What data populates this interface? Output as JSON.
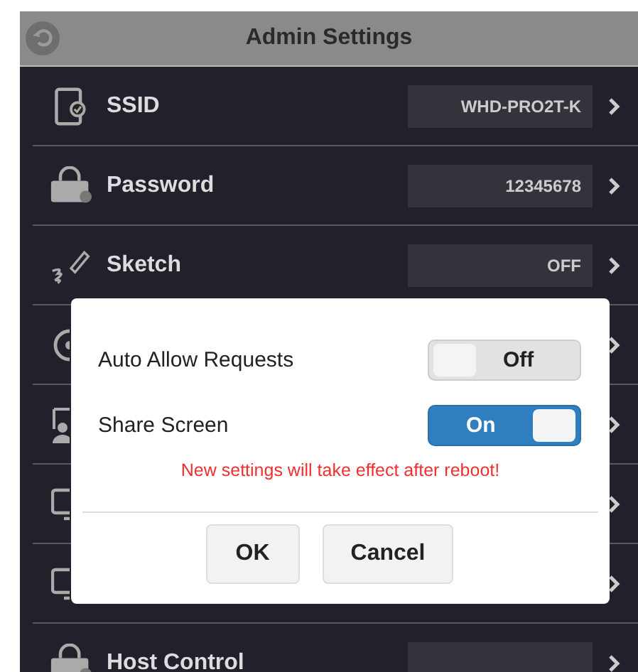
{
  "header": {
    "title": "Admin Settings"
  },
  "rows": [
    {
      "kind": "device",
      "label": "SSID",
      "has_field": true,
      "value": "WHD-PRO2T-K"
    },
    {
      "kind": "lock",
      "label": "Password",
      "has_field": true,
      "value": "12345678"
    },
    {
      "kind": "sketch",
      "label": "Sketch",
      "has_field": true,
      "value": "OFF"
    },
    {
      "kind": "dial"
    },
    {
      "kind": "presenter"
    },
    {
      "kind": "monitor"
    },
    {
      "kind": "monitor"
    },
    {
      "kind": "lock",
      "label": "Host Control",
      "has_field": true
    }
  ],
  "dialog": {
    "toggles": [
      {
        "label": "Auto Allow Requests",
        "on": false,
        "state_text": "Off"
      },
      {
        "label": "Share Screen",
        "on": true,
        "state_text": "On"
      }
    ],
    "notice": "New settings will take effect after reboot!",
    "buttons": [
      "OK",
      "Cancel"
    ]
  }
}
